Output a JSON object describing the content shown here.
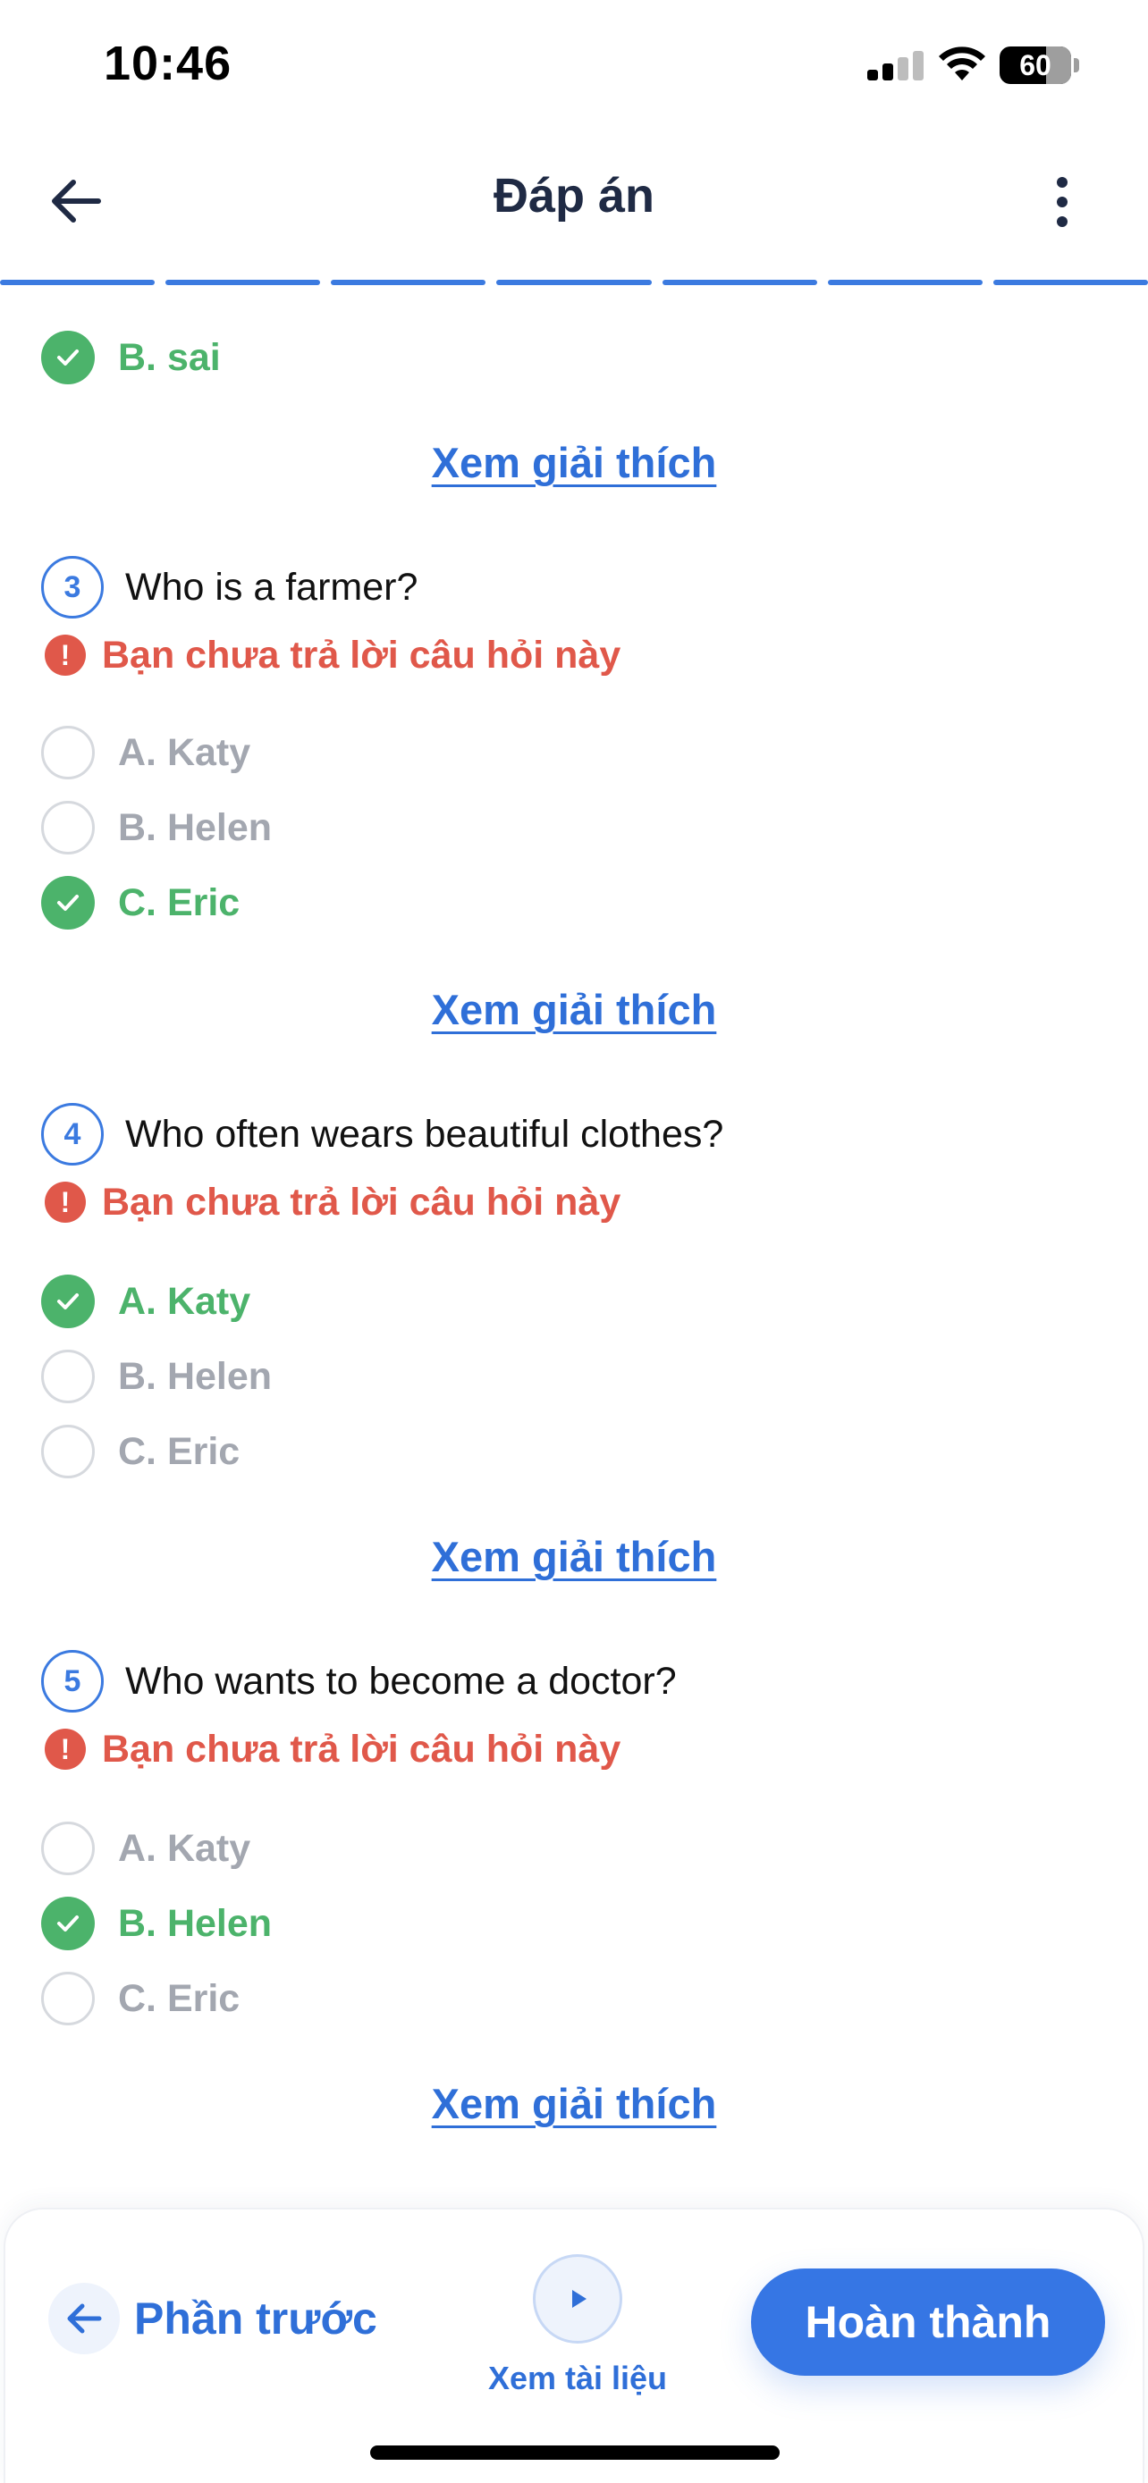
{
  "status_bar": {
    "time": "10:46",
    "battery": "60"
  },
  "header": {
    "title": "Đáp án"
  },
  "progress_segments": 7,
  "top_answer": {
    "label": "B. sai",
    "correct": true
  },
  "explain_label": "Xem giải thích",
  "unanswered_label": "Bạn chưa trả lời câu hỏi này",
  "questions": [
    {
      "number": "3",
      "text": "Who is a farmer?",
      "options": [
        {
          "label": "A. Katy",
          "correct": false
        },
        {
          "label": "B. Helen",
          "correct": false
        },
        {
          "label": "C. Eric",
          "correct": true
        }
      ]
    },
    {
      "number": "4",
      "text": "Who often wears beautiful clothes?",
      "options": [
        {
          "label": "A. Katy",
          "correct": true
        },
        {
          "label": "B. Helen",
          "correct": false
        },
        {
          "label": "C. Eric",
          "correct": false
        }
      ]
    },
    {
      "number": "5",
      "text": "Who wants to become a doctor?",
      "options": [
        {
          "label": "A. Katy",
          "correct": false
        },
        {
          "label": "B. Helen",
          "correct": true
        },
        {
          "label": "C. Eric",
          "correct": false
        }
      ]
    }
  ],
  "bottom_bar": {
    "prev_label": "Phần trước",
    "docs_label": "Xem tài liệu",
    "finish_label": "Hoàn thành"
  },
  "colors": {
    "accent": "#3676e4",
    "correct": "#4cb36b",
    "warning": "#e0584a",
    "muted": "#a3a7b0"
  }
}
